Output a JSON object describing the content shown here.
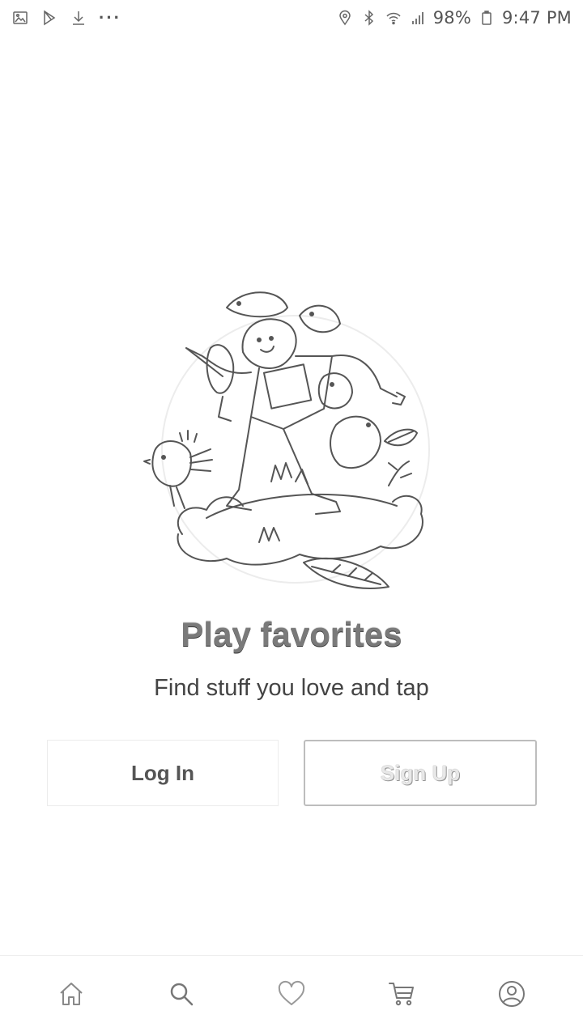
{
  "status_bar": {
    "left_icons": [
      "image-icon",
      "play-store-icon",
      "download-icon",
      "more-dots-icon"
    ],
    "more_dots": "···",
    "right_icons": [
      "location-icon",
      "bluetooth-icon",
      "wifi-icon",
      "signal-icon",
      "battery-icon"
    ],
    "battery_percent": "98%",
    "time": "9:47 PM"
  },
  "onboarding": {
    "illustration": "character-with-animals-illustration",
    "title": "Play favorites",
    "subtitle": "Find stuff you love and tap"
  },
  "auth": {
    "login_label": "Log In",
    "signup_label": "Sign Up"
  },
  "bottom_nav": {
    "items": [
      {
        "icon": "home-icon"
      },
      {
        "icon": "search-icon"
      },
      {
        "icon": "heart-icon"
      },
      {
        "icon": "cart-icon"
      },
      {
        "icon": "profile-icon"
      }
    ]
  }
}
